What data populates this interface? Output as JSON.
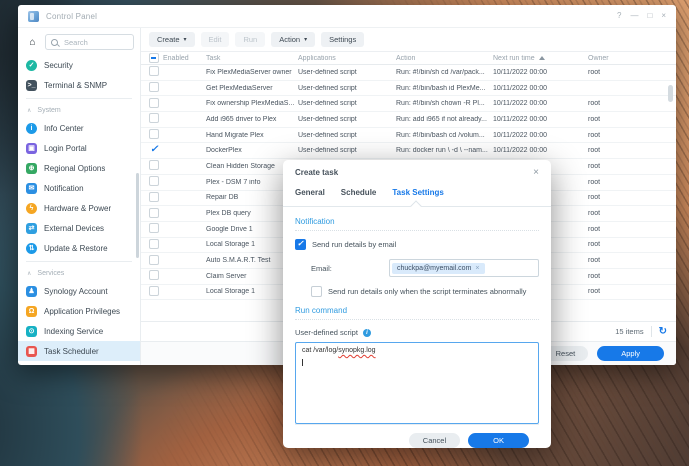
{
  "window": {
    "title": "Control Panel",
    "controls": {
      "help": "?",
      "minimize": "—",
      "maximize": "□",
      "close": "×"
    }
  },
  "sidebar": {
    "search_placeholder": "Search",
    "top_items": [
      {
        "label": "Security",
        "icon": "shield-check-icon",
        "color": "#1db8a3",
        "round": true
      },
      {
        "label": "Terminal & SNMP",
        "icon": "terminal-icon",
        "color": "#43525e"
      }
    ],
    "groups": [
      {
        "label": "System",
        "items": [
          {
            "label": "Info Center",
            "icon": "info-icon",
            "color": "#1c9ae8",
            "round": true
          },
          {
            "label": "Login Portal",
            "icon": "login-portal-icon",
            "color": "#7a64e0"
          },
          {
            "label": "Regional Options",
            "icon": "globe-icon",
            "color": "#35a863"
          },
          {
            "label": "Notification",
            "icon": "megaphone-icon",
            "color": "#2b8fe2"
          },
          {
            "label": "Hardware & Power",
            "icon": "lightbulb-icon",
            "color": "#f5a623",
            "round": true
          },
          {
            "label": "External Devices",
            "icon": "usb-drive-icon",
            "color": "#2f9fe0"
          },
          {
            "label": "Update & Restore",
            "icon": "update-arrows-icon",
            "color": "#1c9ae8",
            "round": true
          }
        ]
      },
      {
        "label": "Services",
        "items": [
          {
            "label": "Synology Account",
            "icon": "user-check-icon",
            "color": "#2b8fe2"
          },
          {
            "label": "Application Privileges",
            "icon": "lock-icon",
            "color": "#f5a623"
          },
          {
            "label": "Indexing Service",
            "icon": "magnifier-icon",
            "color": "#17b1c4"
          },
          {
            "label": "Task Scheduler",
            "icon": "calendar-icon",
            "color": "#e8564f",
            "selected": true
          }
        ]
      }
    ]
  },
  "toolbar": {
    "buttons": [
      {
        "label": "Create",
        "caret": true
      },
      {
        "label": "Edit",
        "disabled": true
      },
      {
        "label": "Run",
        "disabled": true
      },
      {
        "label": "Action",
        "caret": true
      },
      {
        "label": "Settings"
      }
    ]
  },
  "table": {
    "columns": {
      "enabled": "Enabled",
      "task": "Task",
      "applications": "Applications",
      "action": "Action",
      "next_run": "Next run time",
      "owner": "Owner"
    },
    "header_checkbox": "indeterminate",
    "sorted_by": "next_run",
    "rows": [
      {
        "enabled": false,
        "task": "Fix PlexMediaServer owner",
        "applications": "User-defined script",
        "action": "Run: #!/bin/sh cd /var/pack...",
        "next_run": "10/11/2022 00:00",
        "owner": "root"
      },
      {
        "enabled": false,
        "task": "Get PlexMediaServer",
        "applications": "User-defined script",
        "action": "Run: #!/bin/bash id PlexMe...",
        "next_run": "10/11/2022 00:00",
        "owner": ""
      },
      {
        "enabled": false,
        "task": "Fix ownership PlexMediaS...",
        "applications": "User-defined script",
        "action": "Run: #!/bin/sh chown -R Pl...",
        "next_run": "10/11/2022 00:00",
        "owner": "root"
      },
      {
        "enabled": false,
        "task": "Add i965 driver to Plex",
        "applications": "User-defined script",
        "action": "Run: add i965 if not already...",
        "next_run": "10/11/2022 00:00",
        "owner": "root"
      },
      {
        "enabled": false,
        "task": "Hand Migrate Plex",
        "applications": "User-defined script",
        "action": "Run: #!/bin/bash cd /volum...",
        "next_run": "10/11/2022 00:00",
        "owner": "root"
      },
      {
        "enabled": true,
        "task": "DockerPlex",
        "applications": "User-defined script",
        "action": "Run: docker run \\ -d \\ --nam...",
        "next_run": "10/11/2022 00:00",
        "owner": "root"
      },
      {
        "enabled": false,
        "task": "Clean Hidden Storage",
        "applications": "User-defined script",
        "action": "Run: #!/bin/bash # check all...",
        "next_run": "10/11/2022 00:00",
        "owner": "root"
      },
      {
        "enabled": false,
        "task": "Plex - DSM 7 info",
        "applications": "",
        "action": "",
        "next_run": "",
        "owner": "root"
      },
      {
        "enabled": false,
        "task": "Repair DB",
        "applications": "",
        "action": "",
        "next_run": "",
        "owner": "root"
      },
      {
        "enabled": false,
        "task": "Plex DB query",
        "applications": "",
        "action": "",
        "next_run": "",
        "owner": "root"
      },
      {
        "enabled": false,
        "task": "Google Drive 1",
        "applications": "",
        "action": "",
        "next_run": "",
        "owner": "root"
      },
      {
        "enabled": false,
        "task": "Local Storage 1",
        "applications": "",
        "action": "",
        "next_run": "",
        "owner": "root"
      },
      {
        "enabled": false,
        "task": "Auto S.M.A.R.T. Test",
        "applications": "",
        "action": "",
        "next_run": "",
        "owner": "root"
      },
      {
        "enabled": false,
        "task": "Claim Server",
        "applications": "",
        "action": "",
        "next_run": "",
        "owner": "root"
      },
      {
        "enabled": false,
        "task": "Local Storage 1",
        "applications": "",
        "action": "",
        "next_run": "",
        "owner": "root"
      }
    ],
    "items_count": "15 items"
  },
  "footer": {
    "reset": "Reset",
    "apply": "Apply"
  },
  "dialog": {
    "title": "Create task",
    "tabs": [
      {
        "label": "General"
      },
      {
        "label": "Schedule"
      },
      {
        "label": "Task Settings",
        "active": true
      }
    ],
    "notification": {
      "heading": "Notification",
      "email_option": "Send run details by email",
      "email_checked": true,
      "email_label": "Email:",
      "email_token": "chuckpa@myemail.com",
      "abnormal_option": "Send run details only when the script terminates abnormally",
      "abnormal_checked": false
    },
    "run_command": {
      "heading": "Run command",
      "label": "User-defined script",
      "script_prefix": "cat /var/log/",
      "script_misspelled": "synopkg.log"
    },
    "cancel": "Cancel",
    "ok": "OK"
  },
  "colors": {
    "accent": "#1779e8",
    "heading_blue": "#2f9be0",
    "selected_item_bg": "#ddeefa"
  }
}
